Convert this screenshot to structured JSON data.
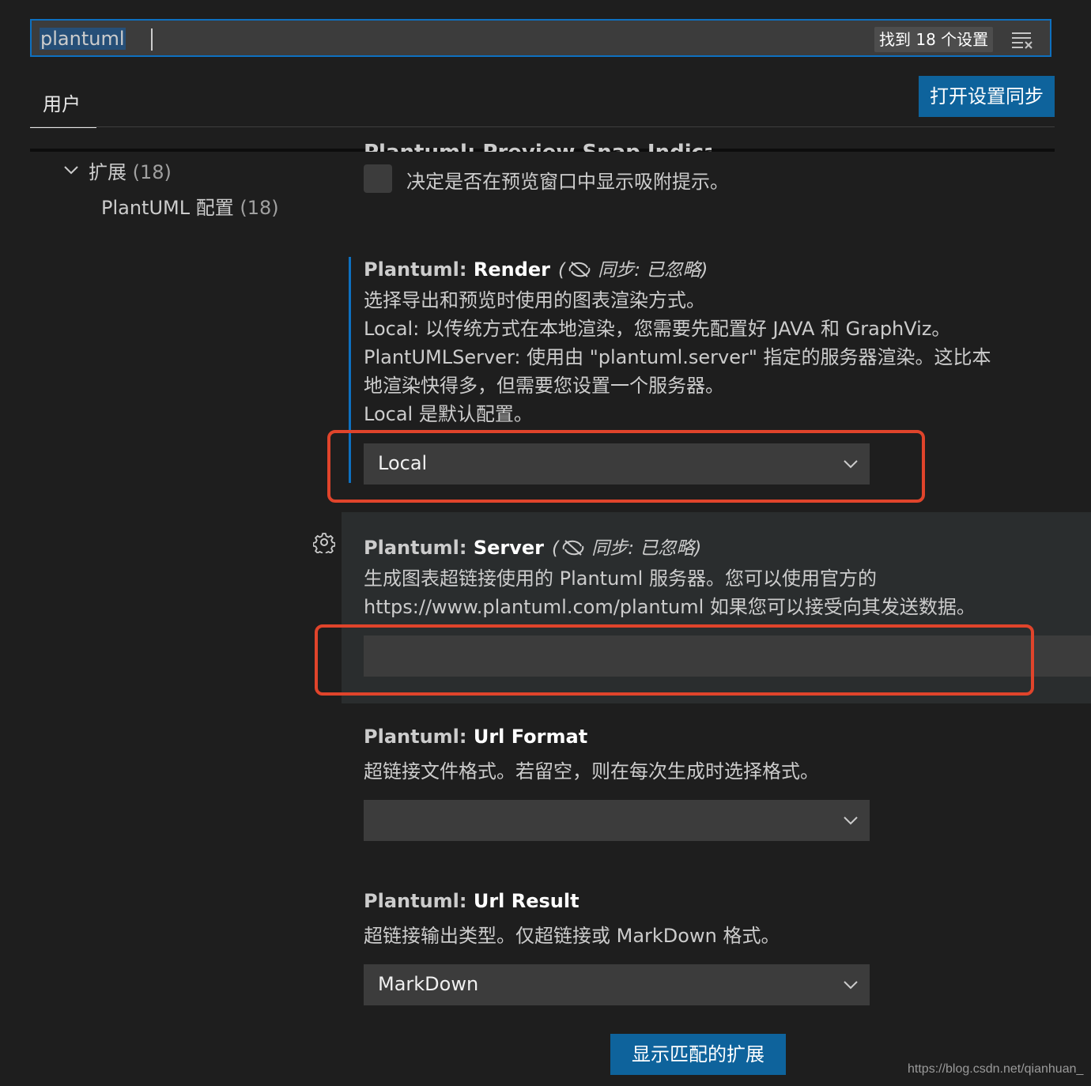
{
  "search": {
    "value": "plantuml",
    "result_count": "找到 18 个设置"
  },
  "tabs": {
    "user": "用户",
    "sync_button": "打开设置同步"
  },
  "toc": {
    "extensions_label": "扩展",
    "extensions_count": "(18)",
    "plantuml_label": "PlantUML 配置",
    "plantuml_count": "(18)"
  },
  "settings": {
    "snap_indicators": {
      "title": "Plantuml: Preview Snap Indicators",
      "description": "决定是否在预览窗口中显示吸附提示。"
    },
    "render": {
      "category": "Plantuml: ",
      "name": "Render",
      "sync_prefix": "(",
      "sync_text": " 同步: 已忽略)",
      "description": [
        "选择导出和预览时使用的图表渲染方式。",
        "Local: 以传统方式在本地渲染，您需要先配置好 JAVA 和 GraphViz。",
        "PlantUMLServer: 使用由 \"plantuml.server\" 指定的服务器渲染。这比本",
        "地渲染快得多，但需要您设置一个服务器。",
        "Local 是默认配置。"
      ],
      "value": "Local"
    },
    "server": {
      "category": "Plantuml: ",
      "name": "Server",
      "sync_prefix": "(",
      "sync_text": " 同步: 已忽略)",
      "description": [
        "生成图表超链接使用的 Plantuml 服务器。您可以使用官方的",
        "https://www.plantuml.com/plantuml 如果您可以接受向其发送数据。"
      ],
      "value": ""
    },
    "url_format": {
      "category": "Plantuml: ",
      "name": "Url Format",
      "description": "超链接文件格式。若留空，则在每次生成时选择格式。",
      "value": ""
    },
    "url_result": {
      "category": "Plantuml: ",
      "name": "Url Result",
      "description": "超链接输出类型。仅超链接或 MarkDown 格式。",
      "value": "MarkDown"
    }
  },
  "show_extensions_button": "显示匹配的扩展",
  "watermark": "https://blog.csdn.net/qianhuan_",
  "colors": {
    "background": "#1e1e1e",
    "accent_blue": "#0e639c",
    "focus_border": "#0e70c0",
    "highlight_red": "#e0442b"
  },
  "icons": {
    "clear_filter": "clear-filter-icon",
    "chevron": "chevron-down-icon",
    "sync_ignored": "sync-ignored-icon",
    "gear": "gear-icon"
  }
}
